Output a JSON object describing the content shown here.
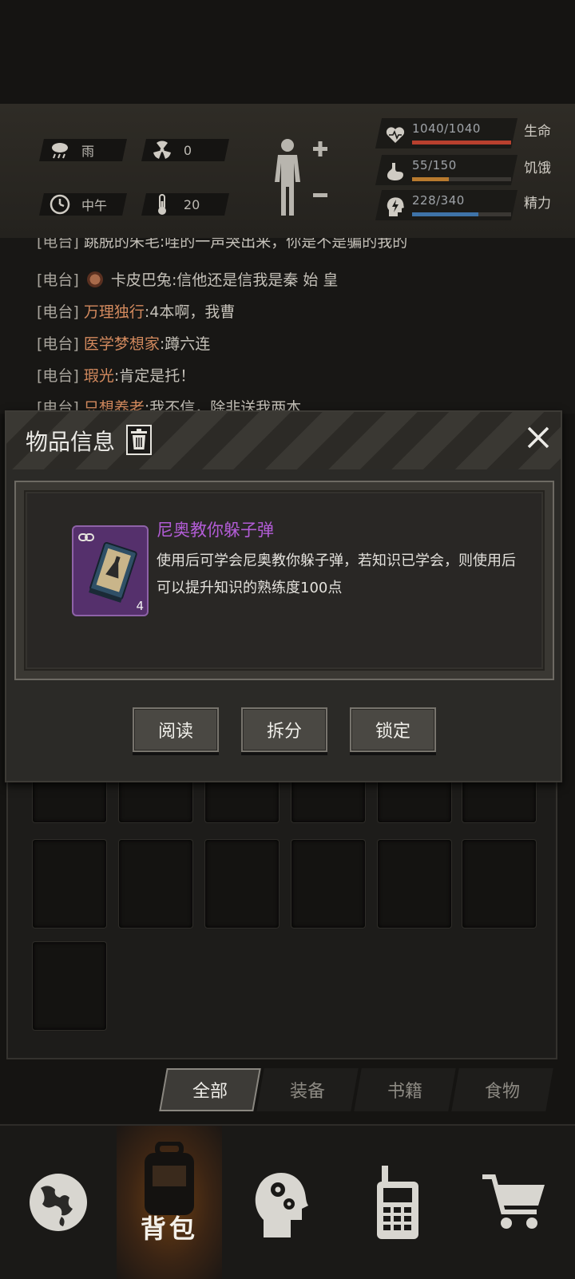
{
  "status": {
    "weather": "雨",
    "radiation": "0",
    "time_of_day": "中午",
    "temperature": "20",
    "vitals": [
      {
        "icon": "heart-icon",
        "value": "1040/1040",
        "name": "生命",
        "fraction": 1.0,
        "color": "#b8402e"
      },
      {
        "icon": "stomach-icon",
        "value": "55/150",
        "name": "饥饿",
        "fraction": 0.367,
        "color": "#b87a2e"
      },
      {
        "icon": "brain-energy-icon",
        "value": "228/340",
        "name": "精力",
        "fraction": 0.671,
        "color": "#3e73a8"
      }
    ]
  },
  "chat": {
    "lines": [
      {
        "tag": "[电台]",
        "name": "跳脱的朱毛",
        "msg": ":哇的一声哭出来，你是不是骗的我的"
      },
      {
        "tag": "[电台]",
        "name": "卡皮巴兔",
        "msg": ":信他还是信我是秦 始 皇"
      },
      {
        "tag": "[电台]",
        "name": "万理独行",
        "msg": ":4本啊，我曹"
      },
      {
        "tag": "[电台]",
        "name": "医学梦想家",
        "msg": ":蹲六连"
      },
      {
        "tag": "[电台]",
        "name": "瑕光",
        "msg": ":肯定是托！"
      },
      {
        "tag": "[电台]",
        "name": "只想养老",
        "msg": ":我不信，除非送我两本"
      }
    ]
  },
  "dialog": {
    "title": "物品信息",
    "item": {
      "name": "尼奥教你躲子弹",
      "count": "4",
      "description_line1": "使用后可学会尼奥教你躲子弹，若知识已学会，则使用后",
      "description_line2": "可以提升知识的熟练度100点"
    },
    "actions": [
      "阅读",
      "拆分",
      "锁定"
    ]
  },
  "tabs": [
    "全部",
    "装备",
    "书籍",
    "食物"
  ],
  "nav": {
    "active_label": "背包"
  }
}
